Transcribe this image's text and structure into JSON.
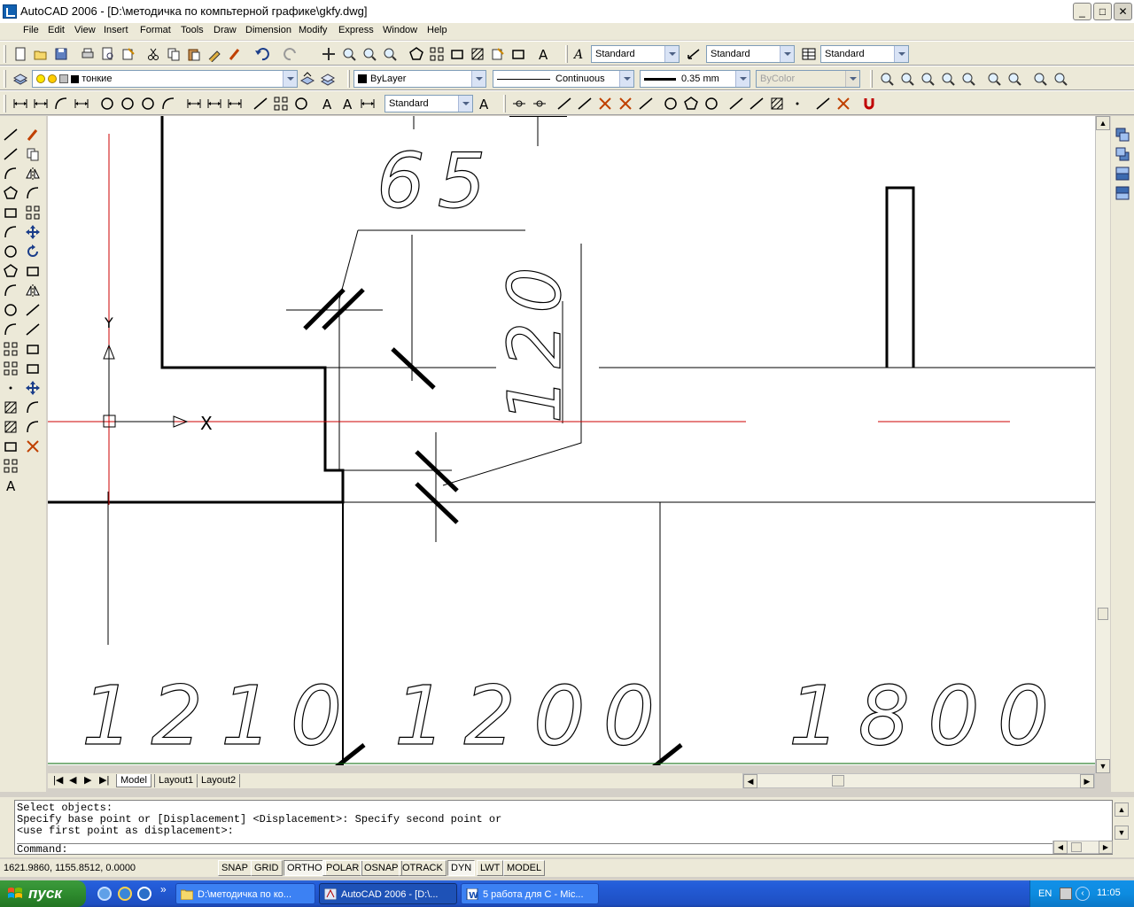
{
  "window": {
    "title": "AutoCAD 2006 - [D:\\методичка по компьтерной графике\\gkfy.dwg]",
    "minimize": "_",
    "maximize": "□",
    "close": "✕"
  },
  "menu": [
    "File",
    "Edit",
    "View",
    "Insert",
    "Format",
    "Tools",
    "Draw",
    "Dimension",
    "Modify",
    "Express",
    "Window",
    "Help"
  ],
  "styles_toolbar": {
    "text_style": "Standard",
    "dim_style": "Standard",
    "table_style": "Standard"
  },
  "layers_toolbar": {
    "layer": "тонкие",
    "color": "ByLayer",
    "linetype": "Continuous",
    "lineweight": "0.35 mm",
    "plot_style": "ByColor"
  },
  "dim_toolbar": {
    "dim_style": "Standard"
  },
  "drawing": {
    "dimensions": [
      "65",
      "120",
      "1210",
      "1200",
      "1800"
    ],
    "ucs_y": "Y",
    "ucs_x": "X",
    "crosshair_color": "#cc0000",
    "bg": "#ffffff"
  },
  "layout_tabs": [
    "Model",
    "Layout1",
    "Layout2"
  ],
  "command_lines": [
    "Select objects:",
    "Specify base point or [Displacement] <Displacement>: Specify second point or",
    "<use first point as displacement>:",
    "Command:"
  ],
  "status": {
    "coords": "1621.9860, 1155.8512, 0.0000",
    "buttons": [
      {
        "label": "SNAP",
        "on": false
      },
      {
        "label": "GRID",
        "on": false
      },
      {
        "label": "ORTHO",
        "on": true
      },
      {
        "label": "POLAR",
        "on": false
      },
      {
        "label": "OSNAP",
        "on": false
      },
      {
        "label": "OTRACK",
        "on": false
      },
      {
        "label": "DYN",
        "on": true
      },
      {
        "label": "LWT",
        "on": false
      },
      {
        "label": "MODEL",
        "on": false
      }
    ]
  },
  "taskbar": {
    "start": "пуск",
    "tasks": [
      {
        "label": "D:\\методичка по ко...",
        "active": false
      },
      {
        "label": "AutoCAD 2006 - [D:\\...",
        "active": true
      },
      {
        "label": "5 работа для С - Mic...",
        "active": false
      }
    ],
    "lang": "EN",
    "time": "11:05"
  }
}
